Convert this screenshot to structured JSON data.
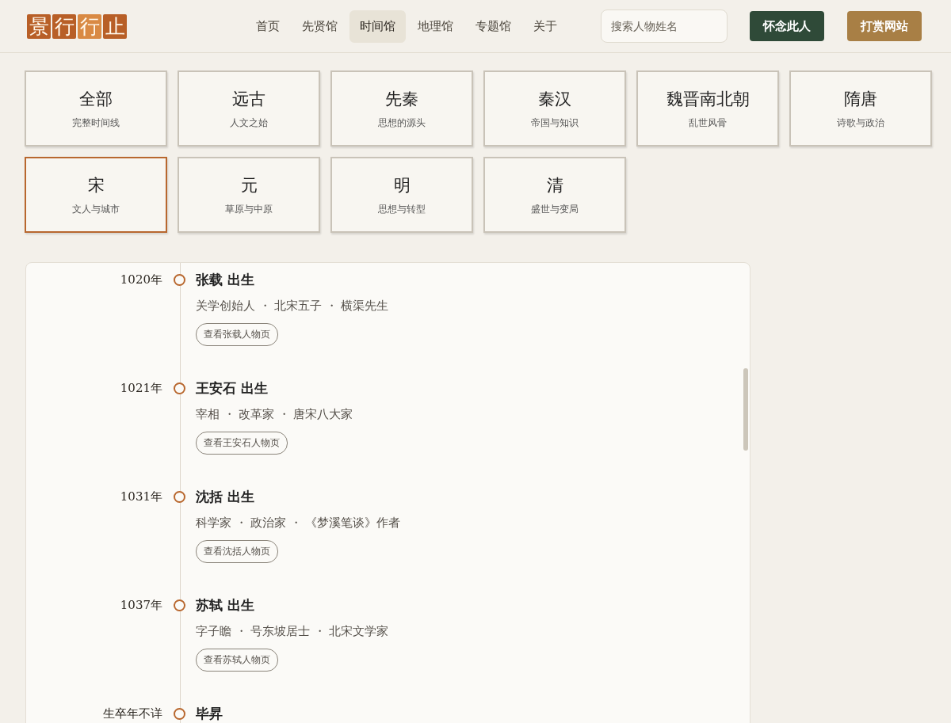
{
  "logo": [
    {
      "char": "景",
      "color": "#b85f27"
    },
    {
      "char": "行",
      "color": "#b85f27"
    },
    {
      "char": "行",
      "color": "#d98a44"
    },
    {
      "char": "止",
      "color": "#b85f27"
    }
  ],
  "nav": [
    {
      "label": "首页",
      "selected": false
    },
    {
      "label": "先贤馆",
      "selected": false
    },
    {
      "label": "时间馆",
      "selected": true
    },
    {
      "label": "地理馆",
      "selected": false
    },
    {
      "label": "专题馆",
      "selected": false
    },
    {
      "label": "关于",
      "selected": false
    }
  ],
  "search": {
    "placeholder": "搜索人物姓名"
  },
  "buttons": [
    {
      "label": "怀念此人",
      "kind": "primary"
    },
    {
      "label": "打赏网站",
      "kind": "accent"
    }
  ],
  "eras": [
    {
      "title": "全部",
      "subtitle": "完整时间线",
      "selected": false
    },
    {
      "title": "远古",
      "subtitle": "人文之始",
      "selected": false
    },
    {
      "title": "先秦",
      "subtitle": "思想的源头",
      "selected": false
    },
    {
      "title": "秦汉",
      "subtitle": "帝国与知识",
      "selected": false
    },
    {
      "title": "魏晋南北朝",
      "subtitle": "乱世风骨",
      "selected": false
    },
    {
      "title": "隋唐",
      "subtitle": "诗歌与政治",
      "selected": false
    },
    {
      "title": "宋",
      "subtitle": "文人与城市",
      "selected": true
    },
    {
      "title": "元",
      "subtitle": "草原与中原",
      "selected": false
    },
    {
      "title": "明",
      "subtitle": "思想与转型",
      "selected": false
    },
    {
      "title": "清",
      "subtitle": "盛世与变局",
      "selected": false
    }
  ],
  "timeline": [
    {
      "year": "1020年",
      "name": "张载",
      "event": "出生",
      "tags": "关学创始人 ・ 北宋五子 ・ 横渠先生",
      "link": "查看张载人物页"
    },
    {
      "year": "1021年",
      "name": "王安石",
      "event": "出生",
      "tags": "宰相 ・ 改革家 ・ 唐宋八大家",
      "link": "查看王安石人物页"
    },
    {
      "year": "1031年",
      "name": "沈括",
      "event": "出生",
      "tags": "科学家 ・ 政治家 ・ 《梦溪笔谈》作者",
      "link": "查看沈括人物页"
    },
    {
      "year": "1037年",
      "name": "苏轼",
      "event": "出生",
      "tags": "字子瞻 ・ 号东坡居士 ・ 北宋文学家",
      "link": "查看苏轼人物页"
    },
    {
      "year": "生卒年不详",
      "name": "毕昇"
    }
  ]
}
